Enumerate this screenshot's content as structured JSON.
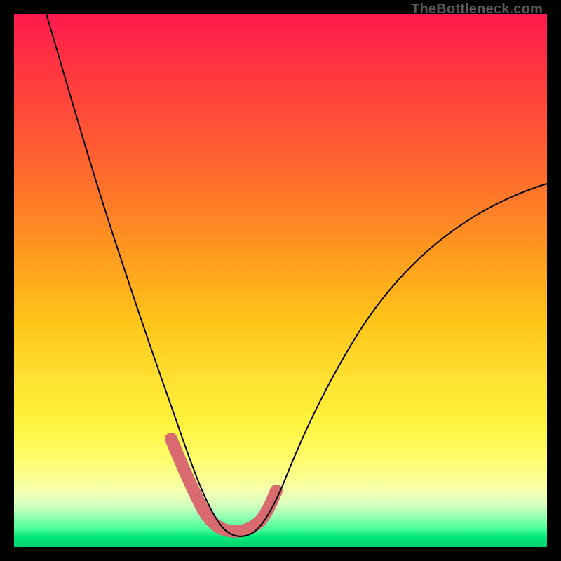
{
  "watermark": "TheBottleneck.com",
  "colors": {
    "pink_highlight": "#d86a70",
    "curve": "#000000"
  },
  "chart_data": {
    "type": "line",
    "title": "",
    "xlabel": "",
    "ylabel": "",
    "xlim": [
      0,
      100
    ],
    "ylim": [
      0,
      100
    ],
    "grid": false,
    "legend": false,
    "annotations": [
      "TheBottleneck.com"
    ],
    "series": [
      {
        "name": "bottleneck-curve",
        "x": [
          6,
          10,
          14,
          18,
          22,
          26,
          30,
          33,
          35,
          37,
          39,
          41,
          44,
          47,
          51,
          56,
          62,
          70,
          80,
          92,
          100
        ],
        "y": [
          100,
          86,
          72,
          58,
          46,
          34,
          22,
          14,
          9,
          5,
          3,
          3,
          3,
          5,
          10,
          18,
          28,
          40,
          52,
          62,
          68
        ]
      }
    ],
    "highlight_range_x": [
      29,
      49
    ],
    "notes": "V-shaped curve with pink highlight overlay near trough; background is a red→yellow→green vertical gradient; no axes or tick labels shown."
  }
}
